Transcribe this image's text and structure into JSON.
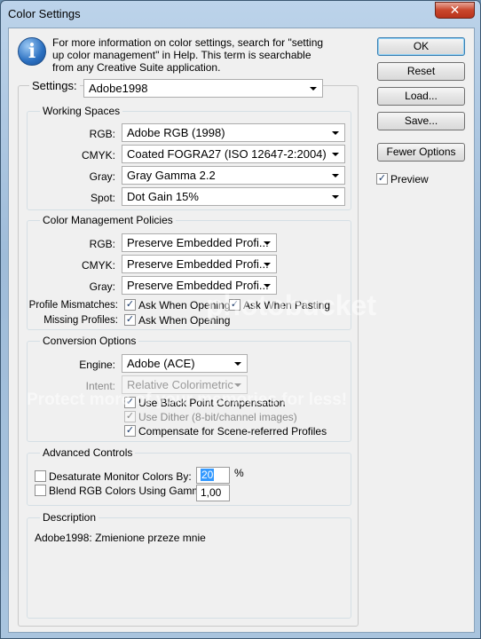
{
  "window": {
    "title": "Color Settings",
    "close_glyph": "✕"
  },
  "info": {
    "icon": "info-icon",
    "icon_glyph": "i",
    "text": "For more information on color settings, search for \"setting up color management\" in Help. This term is searchable from any Creative Suite application."
  },
  "settings": {
    "label": "Settings:",
    "value": "Adobe1998"
  },
  "working_spaces": {
    "legend": "Working Spaces",
    "rows": [
      {
        "label": "RGB:",
        "value": "Adobe RGB (1998)"
      },
      {
        "label": "CMYK:",
        "value": "Coated FOGRA27 (ISO 12647-2:2004)"
      },
      {
        "label": "Gray:",
        "value": "Gray Gamma 2.2"
      },
      {
        "label": "Spot:",
        "value": "Dot Gain 15%"
      }
    ]
  },
  "policies": {
    "legend": "Color Management Policies",
    "rows": [
      {
        "label": "RGB:",
        "value": "Preserve Embedded Profi..."
      },
      {
        "label": "CMYK:",
        "value": "Preserve Embedded Profi..."
      },
      {
        "label": "Gray:",
        "value": "Preserve Embedded Profi..."
      }
    ],
    "mismatch_label": "Profile Mismatches:",
    "mismatch_ask_opening": "Ask When Opening",
    "mismatch_ask_pasting": "Ask When Pasting",
    "missing_label": "Missing Profiles:",
    "missing_ask_opening": "Ask When Opening",
    "check_glyph": "✓"
  },
  "conversion": {
    "legend": "Conversion Options",
    "engine_label": "Engine:",
    "engine_value": "Adobe (ACE)",
    "intent_label": "Intent:",
    "intent_value": "Relative Colorimetric",
    "black_point": "Use Black Point Compensation",
    "dither": "Use Dither (8-bit/channel images)",
    "scene": "Compensate for Scene-referred Profiles"
  },
  "advanced": {
    "legend": "Advanced Controls",
    "desaturate_label": "Desaturate Monitor Colors By:",
    "desaturate_value": "20",
    "desaturate_unit": "%",
    "blend_label": "Blend RGB Colors Using Gamma:",
    "blend_value": "1,00"
  },
  "description": {
    "legend": "Description",
    "text": "Adobe1998:  Zmienione przeze mnie"
  },
  "buttons": {
    "ok": "OK",
    "reset": "Reset",
    "load": "Load...",
    "save": "Save...",
    "fewer_options": "Fewer Options",
    "preview": "Preview"
  },
  "watermark": {
    "brand": "photobucket",
    "slogan": "Protect more of your memories for less!"
  }
}
